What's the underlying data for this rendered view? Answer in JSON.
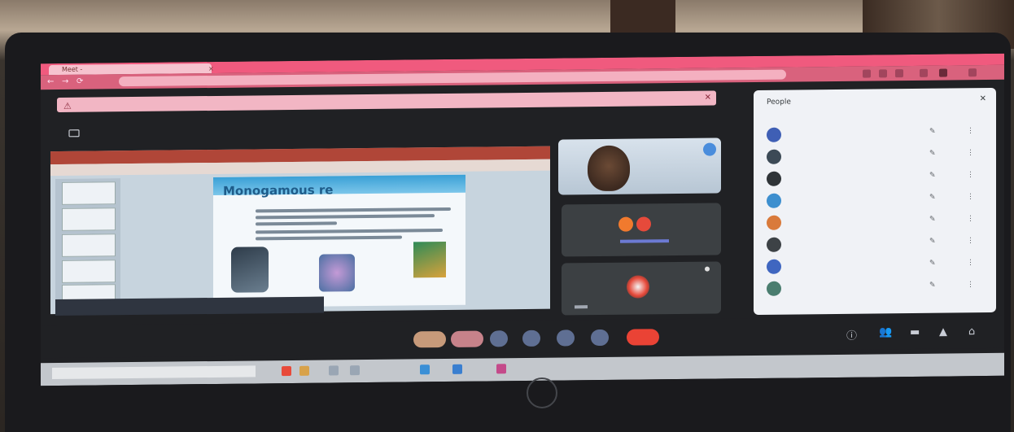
{
  "browser": {
    "tab_title": "Meet - ",
    "tab_close": "×",
    "address": "",
    "nav_back": "←",
    "nav_forward": "→",
    "nav_reload": "⟳"
  },
  "banner": {
    "text": "",
    "close": "✕"
  },
  "meeting": {
    "presenting_label": "",
    "toast_text": "",
    "time": "",
    "slide_title": "Monogamous re"
  },
  "panel": {
    "title": "People",
    "close": "✕",
    "subheading": "",
    "participants": [
      {
        "name": "",
        "color": "#3f5fb5"
      },
      {
        "name": "",
        "color": "#3c4a56"
      },
      {
        "name": "",
        "color": "#2f3438"
      },
      {
        "name": "",
        "color": "#3d8fcf"
      },
      {
        "name": "",
        "color": "#d97a3b"
      },
      {
        "name": "",
        "color": "#3d4246"
      },
      {
        "name": "",
        "color": "#3f66c0"
      },
      {
        "name": "",
        "color": "#4a7d6f"
      }
    ]
  },
  "colors": {
    "chrome_accent": "#f05a7e",
    "meet_bg": "#202124",
    "end_call": "#ea4335"
  }
}
